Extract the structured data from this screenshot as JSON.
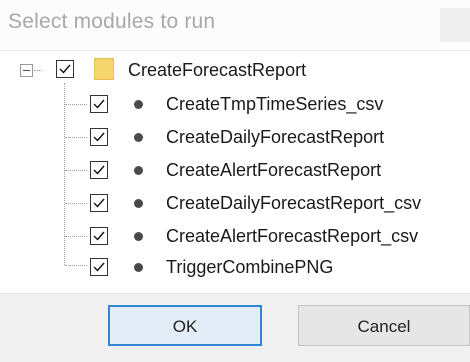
{
  "dialog": {
    "title": "Select modules to run"
  },
  "tree": {
    "root": {
      "label": "CreateForecastReport",
      "checked": true,
      "icon": "folder-icon"
    },
    "children": [
      {
        "label": "CreateTmpTimeSeries_csv",
        "checked": true,
        "icon": "module-dot-icon"
      },
      {
        "label": "CreateDailyForecastReport",
        "checked": true,
        "icon": "module-dot-icon"
      },
      {
        "label": "CreateAlertForecastReport",
        "checked": true,
        "icon": "module-dot-icon"
      },
      {
        "label": "CreateDailyForecastReport_csv",
        "checked": true,
        "icon": "module-dot-icon"
      },
      {
        "label": "CreateAlertForecastReport_csv",
        "checked": true,
        "icon": "module-dot-icon"
      },
      {
        "label": "TriggerCombinePNG",
        "checked": true,
        "icon": "module-dot-icon"
      }
    ]
  },
  "footer": {
    "ok_label": "OK",
    "cancel_label": "Cancel"
  },
  "colors": {
    "accent": "#2f86d6",
    "folder": "#f5d56e"
  }
}
